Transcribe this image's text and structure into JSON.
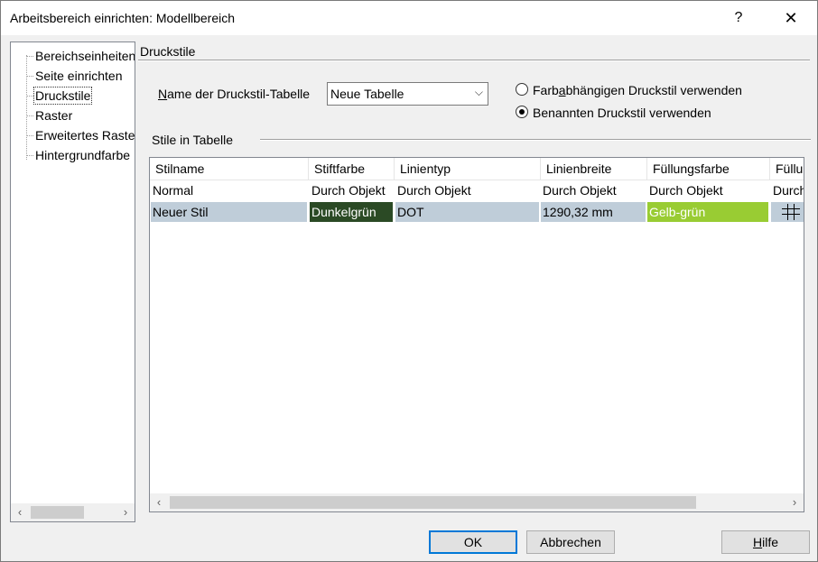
{
  "window": {
    "title": "Arbeitsbereich einrichten: Modellbereich",
    "help_glyph": "?",
    "close_glyph": "✕"
  },
  "tree": {
    "items": [
      {
        "label": "Bereichseinheiten"
      },
      {
        "label": "Seite einrichten"
      },
      {
        "label": "Druckstile",
        "selected": true
      },
      {
        "label": "Raster"
      },
      {
        "label": "Erweitertes Raster"
      },
      {
        "label": "Hintergrundfarbe"
      }
    ],
    "scroll_left": "‹",
    "scroll_right": "›"
  },
  "panel": {
    "group_title": "Druckstile",
    "name_label_pre": "",
    "name_label_accel": "N",
    "name_label_post": "ame der Druckstil-Tabelle",
    "combo_value": "Neue Tabelle",
    "combo_arrow": "⌵",
    "radio1_pre": "Farb",
    "radio1_accel": "a",
    "radio1_post": "bhängigen Druckstil verwenden",
    "radio1_checked": false,
    "radio2_label": "Benannten Druckstil verwenden",
    "radio2_checked": true,
    "stile_title": "Stile in Tabelle"
  },
  "table": {
    "columns": [
      "Stilname",
      "Stiftfarbe",
      "Linientyp",
      "Linienbreite",
      "Füllungsfarbe",
      "Füllungsmuster"
    ],
    "rows": [
      {
        "cells": [
          "Normal",
          "Durch Objekt",
          "Durch Objekt",
          "Durch Objekt",
          "Durch Objekt",
          "Durch Objekt"
        ],
        "selected": false
      },
      {
        "cells": [
          "Neuer Stil",
          "Dunkelgrün",
          "DOT",
          "1290,32 mm",
          "Gelb-grün",
          ""
        ],
        "selected": true
      }
    ],
    "colors": {
      "dunkelgruen": "#2b4a25",
      "gelbgruen": "#99cc33",
      "selection": "#bfcdd9"
    },
    "scroll_left": "‹",
    "scroll_right": "›"
  },
  "buttons": {
    "ok": "OK",
    "cancel": "Abbrechen",
    "help_accel": "H",
    "help_post": "ilfe"
  }
}
